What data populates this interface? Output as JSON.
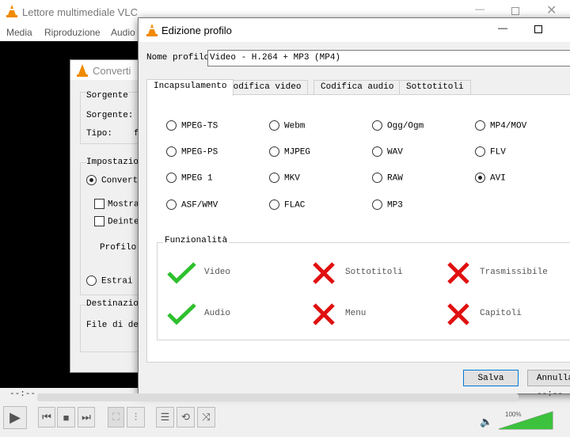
{
  "main_window": {
    "title": "Lettore multimediale VLC",
    "menu": [
      "Media",
      "Riproduzione",
      "Audio"
    ],
    "time_elapsed": "--:--",
    "time_total": "--:--",
    "volume": "100%",
    "volume_fraction": 1.0
  },
  "convert_dialog": {
    "title": "Converti",
    "source_group": "Sorgente",
    "source_label": "Sorgente:",
    "type_label": "Tipo:",
    "type_value": "f",
    "settings_group": "Impostazion",
    "convert_radio": "Converti",
    "show_output": "Mostra",
    "deinterlace": "Deinter",
    "profile_label": "Profilo",
    "extract_radio": "Estrai i",
    "destination_group": "Destinazion",
    "dest_file_label": "File di des"
  },
  "profile_dialog": {
    "title": "Edizione profilo",
    "name_label": "Nome profilo",
    "name_value": "Video - H.264 + MP3 (MP4)",
    "tabs": [
      "Incapsulamento",
      "Codifica video",
      "Codifica audio",
      "Sottotitoli"
    ],
    "containers": [
      [
        "MPEG-TS",
        "Webm",
        "Ogg/Ogm",
        "MP4/MOV"
      ],
      [
        "MPEG-PS",
        "MJPEG",
        "WAV",
        "FLV"
      ],
      [
        "MPEG 1",
        "MKV",
        "RAW",
        "AVI"
      ],
      [
        "ASF/WMV",
        "FLAC",
        "MP3"
      ]
    ],
    "selected": "AVI",
    "features_group": "Funzionalità",
    "features": [
      {
        "label": "Video",
        "supported": true
      },
      {
        "label": "Sottotitoli",
        "supported": false
      },
      {
        "label": "Trasmissibile",
        "supported": false
      },
      {
        "label": "Audio",
        "supported": true
      },
      {
        "label": "Menu",
        "supported": false
      },
      {
        "label": "Capitoli",
        "supported": false
      }
    ],
    "save": "Salva",
    "cancel": "Annulla"
  },
  "colors": {
    "check": "#2ec02e",
    "cross": "#e01010",
    "volume": "#3cc23c"
  }
}
